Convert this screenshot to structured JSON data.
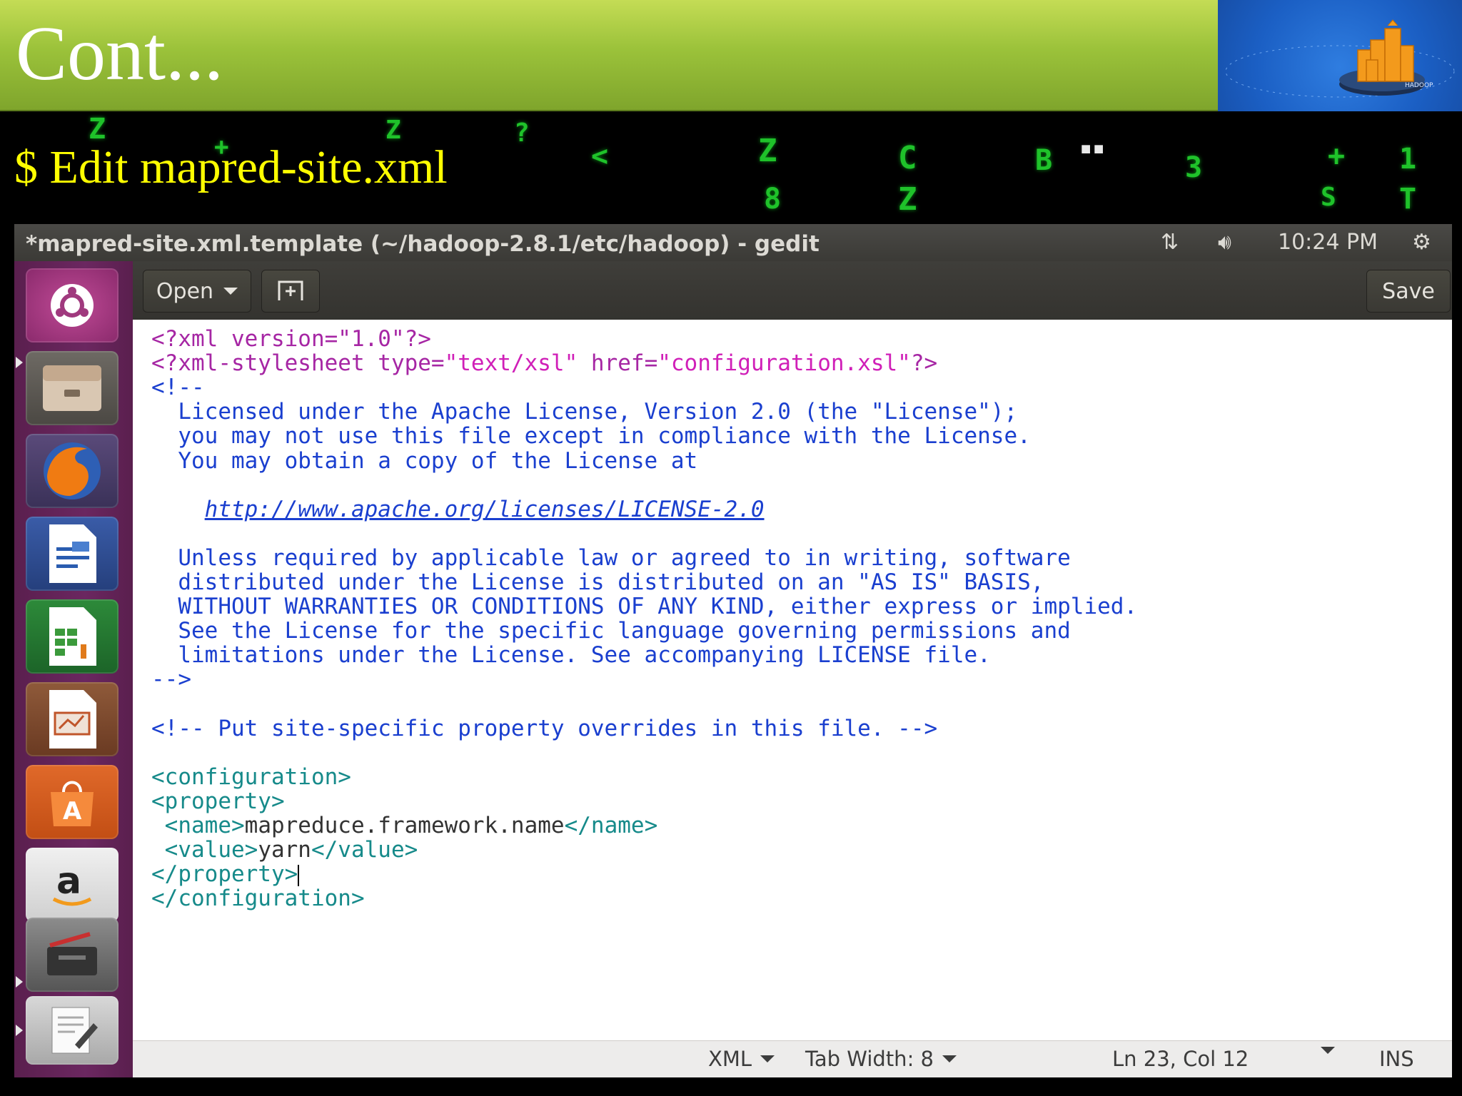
{
  "slide": {
    "title": "Cont...",
    "subtitle": "$ Edit mapred-site.xml"
  },
  "window": {
    "title": "*mapred-site.xml.template (~/hadoop-2.8.1/etc/hadoop) - gedit",
    "time": "10:24 PM"
  },
  "toolbar": {
    "open_label": "Open",
    "save_label": "Save"
  },
  "editor": {
    "lines": [
      [
        {
          "t": "<?xml version=\"1.0\"?>",
          "c": "pi"
        }
      ],
      [
        {
          "t": "<?xml-stylesheet type=",
          "c": "pi"
        },
        {
          "t": "\"text/xsl\"",
          "c": "str"
        },
        {
          "t": " href=",
          "c": "pi"
        },
        {
          "t": "\"configuration.xsl\"",
          "c": "str"
        },
        {
          "t": "?>",
          "c": "pi"
        }
      ],
      [
        {
          "t": "<!--",
          "c": "comment"
        }
      ],
      [
        {
          "t": "  Licensed under the Apache License, Version 2.0 (the \"License\");",
          "c": "comment"
        }
      ],
      [
        {
          "t": "  you may not use this file except in compliance with the License.",
          "c": "comment"
        }
      ],
      [
        {
          "t": "  You may obtain a copy of the License at",
          "c": "comment"
        }
      ],
      [
        {
          "t": "",
          "c": "comment"
        }
      ],
      [
        {
          "t": "    ",
          "c": "comment"
        },
        {
          "t": "http://www.apache.org/licenses/LICENSE-2.0",
          "c": "link"
        }
      ],
      [
        {
          "t": "",
          "c": "comment"
        }
      ],
      [
        {
          "t": "  Unless required by applicable law or agreed to in writing, software",
          "c": "comment"
        }
      ],
      [
        {
          "t": "  distributed under the License is distributed on an \"AS IS\" BASIS,",
          "c": "comment"
        }
      ],
      [
        {
          "t": "  WITHOUT WARRANTIES OR CONDITIONS OF ANY KIND, either express or implied.",
          "c": "comment"
        }
      ],
      [
        {
          "t": "  See the License for the specific language governing permissions and",
          "c": "comment"
        }
      ],
      [
        {
          "t": "  limitations under the License. See accompanying LICENSE file.",
          "c": "comment"
        }
      ],
      [
        {
          "t": "-->",
          "c": "comment"
        }
      ],
      [
        {
          "t": "",
          "c": "text"
        }
      ],
      [
        {
          "t": "<!-- Put site-specific property overrides in this file. -->",
          "c": "comment"
        }
      ],
      [
        {
          "t": "",
          "c": "text"
        }
      ],
      [
        {
          "t": "<configuration>",
          "c": "tag"
        }
      ],
      [
        {
          "t": "<property>",
          "c": "tag"
        }
      ],
      [
        {
          "t": " <name>",
          "c": "tag"
        },
        {
          "t": "mapreduce.framework.name",
          "c": "text"
        },
        {
          "t": "</name>",
          "c": "tag"
        }
      ],
      [
        {
          "t": " <value>",
          "c": "tag"
        },
        {
          "t": "yarn",
          "c": "text"
        },
        {
          "t": "</value>",
          "c": "tag"
        }
      ],
      [
        {
          "t": "</property>",
          "c": "tag"
        },
        {
          "t": "",
          "c": "cursor"
        }
      ],
      [
        {
          "t": "</configuration>",
          "c": "tag"
        }
      ]
    ]
  },
  "statusbar": {
    "language": "XML",
    "tab_width": "Tab Width: 8",
    "position": "Ln 23, Col 12",
    "mode": "INS"
  },
  "launcher": {
    "items": [
      "ubuntu-dash-icon",
      "files-icon",
      "firefox-icon",
      "writer-icon",
      "calc-icon",
      "impress-icon",
      "software-center-icon",
      "amazon-icon",
      "system-settings-icon",
      "text-editor-icon",
      "trash-icon"
    ]
  }
}
